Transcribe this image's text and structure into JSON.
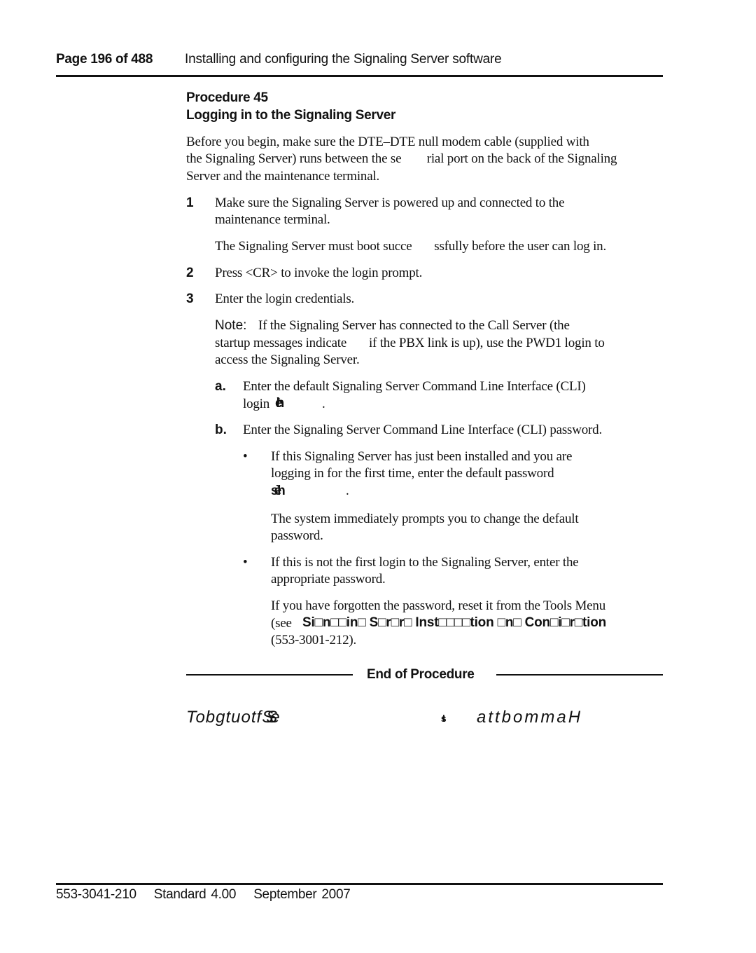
{
  "header": {
    "page_label": "Page 196 of 488",
    "section_title": "Installing and configuring the Signaling Server software"
  },
  "procedure": {
    "number_label": "Procedure 45",
    "title": "Logging in to the Signaling Server",
    "intro": [
      "Before you begin, make sure the DTE–DTE null modem cable (supplied with",
      "the Signaling Server) runs between the se        rial port on the back of the Signaling",
      "Server and the maintenance terminal."
    ],
    "steps": [
      {
        "number": "1",
        "lines": [
          "Make sure the Signaling Server is powered up and connected to the",
          "maintenance terminal."
        ],
        "detail": "The Signaling Server must boot succe       ssfully before the user can log in."
      },
      {
        "number": "2",
        "lines": [
          "Press <CR> to invoke the login prompt."
        ]
      },
      {
        "number": "3",
        "lines": [
          "Enter the login credentials."
        ],
        "note_label": "Note:",
        "note_lines": [
          "If the Signaling Server has connected to the Call Server (the",
          "startup messages indicate       if the PBX link is up), use the PWD1 login to",
          "access the Signaling Server."
        ],
        "substeps": [
          {
            "letter": "a.",
            "line1": "Enter the default Signaling Server Command Line Interface (CLI)",
            "line2_prefix": "login",
            "line2_code": "èh",
            "line2_suffix": "."
          },
          {
            "letter": "b.",
            "line1": "Enter the Signaling Server Command Line Interface (CLI) password.",
            "bullets": [
              {
                "symbol": "•",
                "lines": [
                  "If this Signaling Server has just been installed and you are",
                  "logging in for the first time, enter the default password"
                ],
                "code": "sèh",
                "code_suffix": ".",
                "follow_lines": [
                  "The system immediately prompts you to change the default",
                  "password."
                ]
              },
              {
                "symbol": "•",
                "lines": [
                  "If this is not the first login to the Signaling Server, enter the",
                  "appropriate password."
                ],
                "follow_lines": [
                  "If you have forgotten the password, reset it from the Tools Menu"
                ],
                "ref_prefix": "(see",
                "ref_title": "Si□n□□in□ S□r□r□ Inst□□□□tion □n□ Con□i□r□tion",
                "ref_number": "(553-3001-212)."
              }
            ]
          }
        ]
      }
    ],
    "end_label": "End of Procedure"
  },
  "garbled_line": {
    "part1": "Tobgtuotf",
    "part1_overlap": "SSe",
    "part2": "ist",
    "part3": "attbommaH"
  },
  "footer": {
    "doc_number": "553-3041-210",
    "standard": "Standard 4.00",
    "date": "September 2007"
  }
}
